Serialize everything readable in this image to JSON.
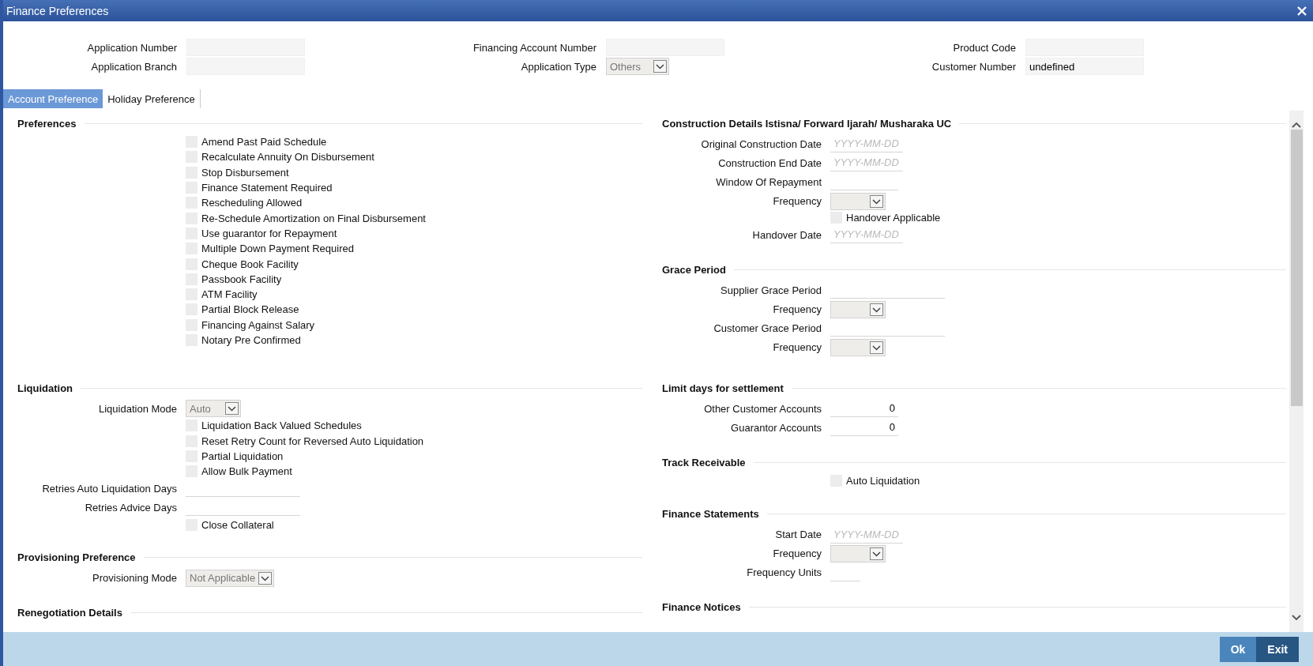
{
  "window": {
    "title": "Finance Preferences"
  },
  "header_fields": [
    {
      "kind": "text",
      "label": "Application Number"
    },
    {
      "kind": "text",
      "label": "Financing Account Number"
    },
    {
      "kind": "text",
      "label": "Product Code"
    },
    {
      "kind": "text",
      "label": "Application Branch"
    },
    {
      "kind": "select",
      "label": "Application Type",
      "value": "Others"
    },
    {
      "kind": "text",
      "label": "Customer Number",
      "value": "undefined"
    }
  ],
  "tabs": [
    {
      "label": "Account Preference",
      "selected": true
    },
    {
      "label": "Holiday Preference",
      "selected": false
    }
  ],
  "section_rows": [
    {
      "left": [
        {
          "title": "Preferences",
          "items": [
            {
              "kind": "checkbox",
              "label": "Amend Past Paid Schedule",
              "checked": false
            },
            {
              "kind": "checkbox",
              "label": "Recalculate Annuity On Disbursement",
              "checked": false
            },
            {
              "kind": "checkbox",
              "label": "Stop Disbursement",
              "checked": false
            },
            {
              "kind": "checkbox",
              "label": "Finance Statement Required",
              "checked": false
            },
            {
              "kind": "checkbox",
              "label": "Rescheduling Allowed",
              "checked": false
            },
            {
              "kind": "checkbox",
              "label": "Re-Schedule Amortization on Final Disbursement",
              "checked": false
            },
            {
              "kind": "checkbox",
              "label": "Use guarantor for Repayment",
              "checked": false
            },
            {
              "kind": "checkbox",
              "label": "Multiple Down Payment Required",
              "checked": false
            },
            {
              "kind": "checkbox",
              "label": "Cheque Book Facility",
              "checked": false
            },
            {
              "kind": "checkbox",
              "label": "Passbook Facility",
              "checked": false
            },
            {
              "kind": "checkbox",
              "label": "ATM Facility",
              "checked": false
            },
            {
              "kind": "checkbox",
              "label": "Partial Block Release",
              "checked": false
            },
            {
              "kind": "checkbox",
              "label": "Financing Against Salary",
              "checked": false
            },
            {
              "kind": "checkbox",
              "label": "Notary Pre Confirmed",
              "checked": false
            }
          ]
        }
      ],
      "right": [
        {
          "title": "Construction Details Istisna/ Forward Ijarah/ Musharaka UC",
          "items": [
            {
              "kind": "date",
              "label": "Original Construction Date",
              "placeholder": "YYYY-MM-DD"
            },
            {
              "kind": "date",
              "label": "Construction End Date",
              "placeholder": "YYYY-MM-DD"
            },
            {
              "kind": "short",
              "label": "Window Of Repayment"
            },
            {
              "kind": "select",
              "label": "Frequency"
            },
            {
              "kind": "checkbox",
              "label": "Handover Applicable",
              "checked": false
            },
            {
              "kind": "date",
              "label": "Handover Date",
              "placeholder": "YYYY-MM-DD"
            }
          ]
        },
        {
          "title": "Grace Period",
          "items": [
            {
              "kind": "text",
              "label": "Supplier Grace Period"
            },
            {
              "kind": "select",
              "label": "Frequency"
            },
            {
              "kind": "text",
              "label": "Customer Grace Period"
            },
            {
              "kind": "select",
              "label": "Frequency"
            }
          ]
        }
      ]
    },
    {
      "left": [
        {
          "title": "Liquidation",
          "items": [
            {
              "kind": "select",
              "label": "Liquidation Mode",
              "value": "Auto"
            },
            {
              "kind": "checkbox",
              "label": "Liquidation Back Valued Schedules",
              "checked": false
            },
            {
              "kind": "checkbox",
              "label": "Reset Retry Count for Reversed Auto Liquidation",
              "checked": false
            },
            {
              "kind": "checkbox",
              "label": "Partial Liquidation",
              "checked": false
            },
            {
              "kind": "checkbox",
              "label": "Allow Bulk Payment",
              "checked": false
            },
            {
              "kind": "text",
              "label": "Retries Auto Liquidation Days"
            },
            {
              "kind": "text",
              "label": "Retries Advice Days"
            },
            {
              "kind": "checkbox",
              "label": "Close Collateral",
              "checked": false
            }
          ]
        },
        {
          "title": "Provisioning Preference",
          "items": [
            {
              "kind": "select",
              "label": "Provisioning Mode",
              "value": "Not Applicable"
            }
          ]
        },
        {
          "title": "Renegotiation Details"
        }
      ],
      "right": [
        {
          "title": "Limit days for settlement",
          "items": [
            {
              "kind": "number",
              "label": "Other Customer Accounts",
              "value": "0"
            },
            {
              "kind": "number",
              "label": "Guarantor Accounts",
              "value": "0"
            }
          ]
        },
        {
          "title": "Track Receivable",
          "items": [
            {
              "kind": "checkbox",
              "label": "Auto Liquidation",
              "checked": false
            }
          ]
        },
        {
          "title": "Finance Statements",
          "items": [
            {
              "kind": "date",
              "label": "Start Date",
              "placeholder": "YYYY-MM-DD"
            },
            {
              "kind": "select",
              "label": "Frequency"
            },
            {
              "kind": "tiny",
              "label": "Frequency Units"
            }
          ]
        },
        {
          "title": "Finance Notices"
        }
      ]
    }
  ],
  "buttons": [
    {
      "label": "Ok",
      "focused": false
    },
    {
      "label": "Exit",
      "focused": true
    }
  ]
}
